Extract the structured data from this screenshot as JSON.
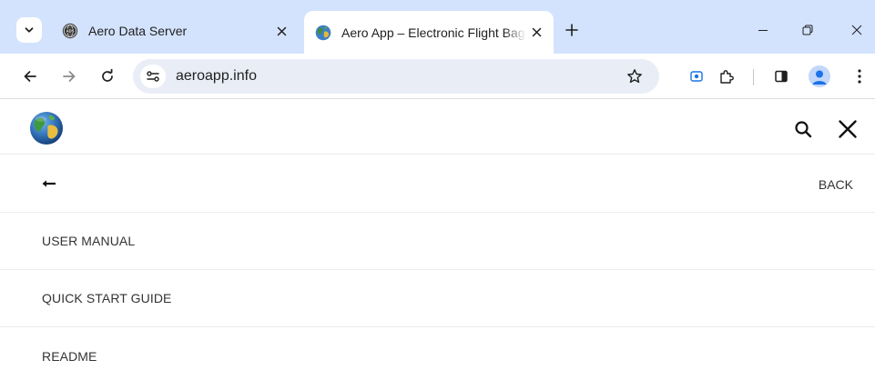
{
  "browser": {
    "tabs": [
      {
        "title": "Aero Data Server",
        "favicon": "ads-globe-icon",
        "active": false
      },
      {
        "title": "Aero App – Electronic Flight Bag",
        "favicon": "earth-globe-icon",
        "active": true
      }
    ],
    "url": "aeroapp.info",
    "accent_color": "#d3e3fd",
    "profile_color": "#1a73e8"
  },
  "site": {
    "logo": "earth-globe-icon",
    "back_label": "BACK",
    "menu": [
      {
        "label": "USER MANUAL"
      },
      {
        "label": "QUICK START GUIDE"
      },
      {
        "label": "README"
      }
    ]
  }
}
